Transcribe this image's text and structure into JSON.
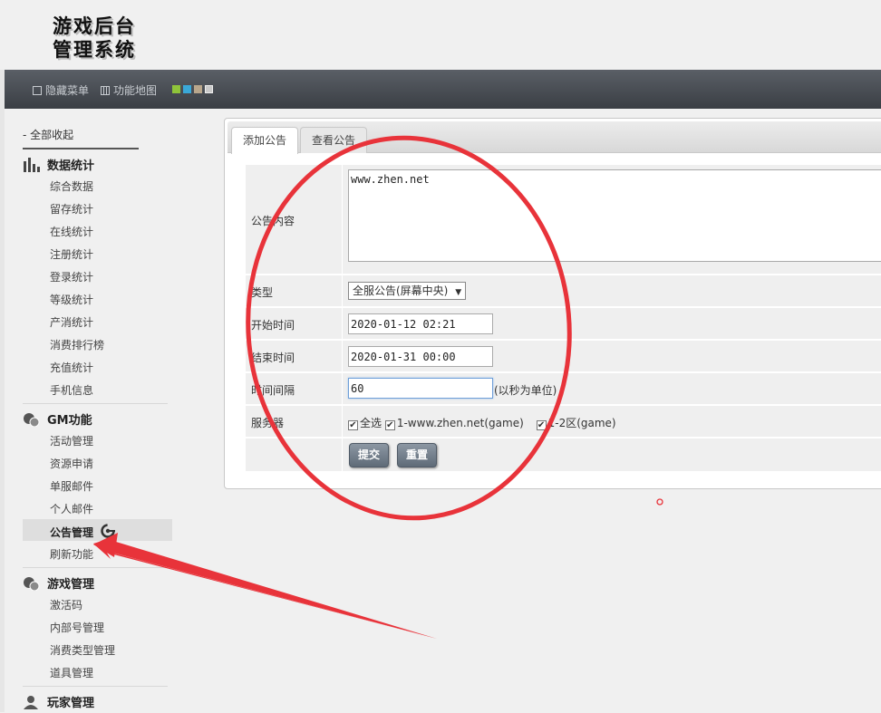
{
  "header": {
    "logo_line1": "游戏后台",
    "logo_line2": "管理系统"
  },
  "toolbar": {
    "hide_menu": "隐藏菜单",
    "function_map": "功能地图",
    "theme_swatches": [
      "#8fc43a",
      "#3aa8d8",
      "#b8a68c",
      "#c9c9c9"
    ]
  },
  "sidebar": {
    "collapse_all": "- 全部收起",
    "groups": [
      {
        "title": "数据统计",
        "icon": "bar-chart-icon",
        "items": [
          "综合数据",
          "留存统计",
          "在线统计",
          "注册统计",
          "登录统计",
          "等级统计",
          "产消统计",
          "消费排行榜",
          "充值统计",
          "手机信息"
        ]
      },
      {
        "title": "GM功能",
        "icon": "gm-tools-icon",
        "items": [
          "活动管理",
          "资源申请",
          "单服邮件",
          "个人邮件",
          "公告管理",
          "刷新功能"
        ],
        "active": "公告管理"
      },
      {
        "title": "游戏管理",
        "icon": "game-tools-icon",
        "items": [
          "激活码",
          "内部号管理",
          "消费类型管理",
          "道具管理"
        ]
      },
      {
        "title": "玩家管理",
        "icon": "user-icon",
        "items": []
      }
    ]
  },
  "tabs": [
    {
      "label": "添加公告",
      "active": true
    },
    {
      "label": "查看公告",
      "active": false
    }
  ],
  "form": {
    "content_label": "公告内容",
    "content_value": "www.zhen.net",
    "type_label": "类型",
    "type_value": "全服公告(屏幕中央)",
    "start_label": "开始时间",
    "start_value": "2020-01-12 02:21",
    "end_label": "结束时间",
    "end_value": "2020-01-31 00:00",
    "interval_label": "时间间隔",
    "interval_value": "60",
    "interval_unit": "(以秒为单位)",
    "server_label": "服务器",
    "server_all": "全选",
    "server_1": "1-www.zhen.net(game)",
    "server_2": "1-2区(game)",
    "submit_label": "提交",
    "reset_label": "重置"
  },
  "annotation": {
    "color": "#e8333a"
  }
}
